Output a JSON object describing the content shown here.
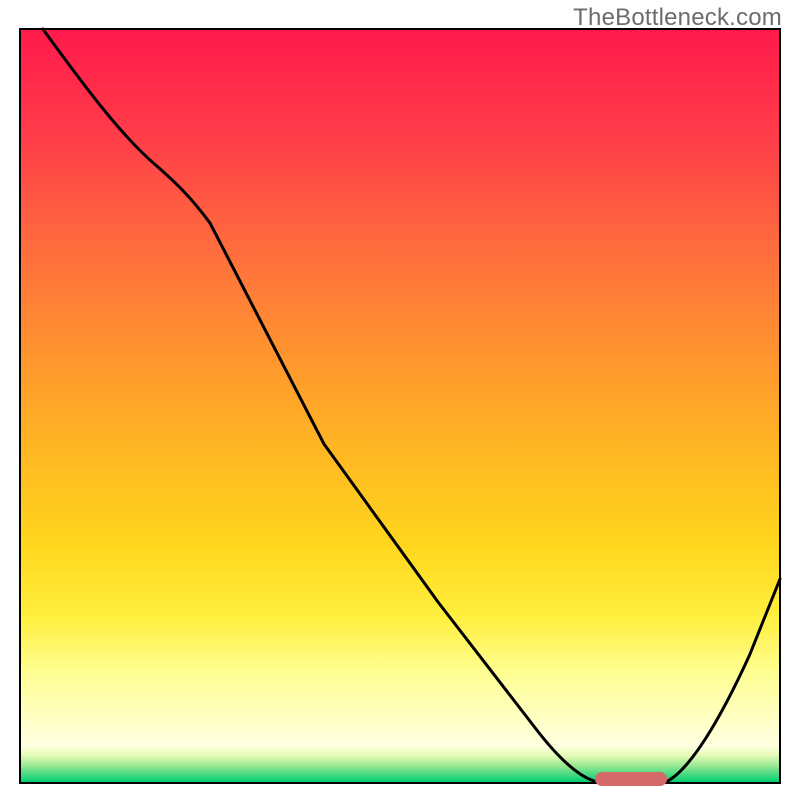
{
  "watermark": "TheBottleneck.com",
  "colors": {
    "top": "#ff1a4b",
    "mid_upper": "#ff8b2e",
    "mid": "#ffd21f",
    "mid_lower": "#ffff78",
    "pale_band": "#ffffe1",
    "green_top": "#b9f2a3",
    "green_bottom": "#00ce72",
    "stroke": "#000000",
    "marker": "#d66a6a"
  },
  "chart_data": {
    "type": "line",
    "title": "",
    "xlabel": "",
    "ylabel": "",
    "xlim": [
      0,
      100
    ],
    "ylim": [
      0,
      100
    ],
    "x": [
      3,
      10,
      18,
      25,
      32,
      40,
      48,
      55,
      62,
      68,
      72,
      76,
      80,
      85,
      90,
      96,
      100
    ],
    "values": [
      100,
      92,
      84,
      78,
      67,
      56,
      45,
      34,
      24,
      14,
      7,
      2,
      0,
      0,
      6,
      17,
      27
    ],
    "marker": {
      "x_start": 76,
      "x_end": 85,
      "y": 0
    },
    "minimum_at_x": 80,
    "minimum_value": 0
  }
}
